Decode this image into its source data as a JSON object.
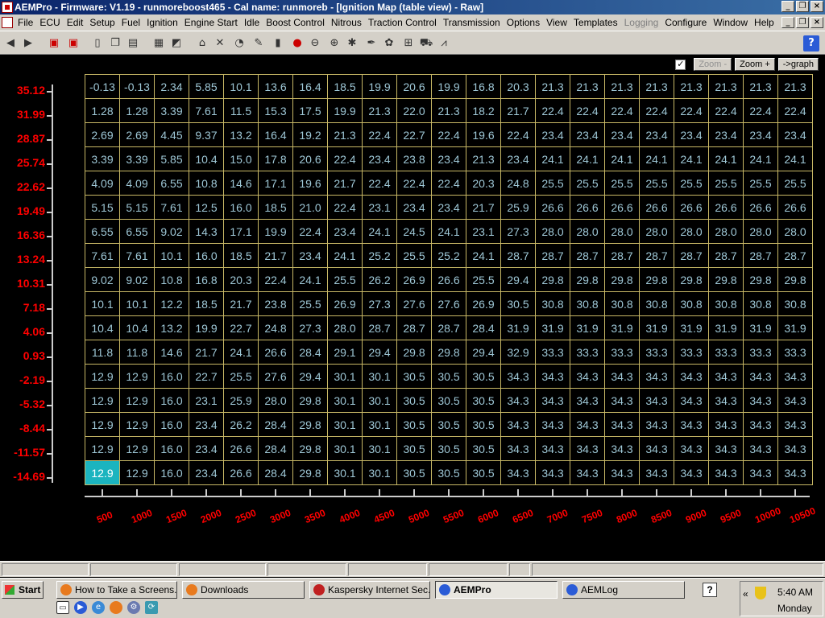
{
  "window": {
    "title": "AEMPro - Firmware: V1.19 - runmoreboost465 - Cal name: runmoreb - [Ignition Map (table view) - Raw]"
  },
  "menu": [
    "File",
    "ECU",
    "Edit",
    "Setup",
    "Fuel",
    "Ignition",
    "Engine Start",
    "Idle",
    "Boost Control",
    "Nitrous",
    "Traction Control",
    "Transmission",
    "Options",
    "View",
    "Templates",
    "Logging",
    "Configure",
    "Window",
    "Help"
  ],
  "menu_disabled": [
    "Logging"
  ],
  "toolbar_icons": [
    "back-arrow-icon",
    "forward-arrow-icon",
    "ecu-open-icon",
    "ecu-save-icon",
    "new-document-icon",
    "copy-document-icon",
    "paste-document-icon",
    "table-icon",
    "chart-icon",
    "home-icon",
    "tools-icon",
    "gauge-icon",
    "wrench-icon",
    "injector-icon",
    "start-icon",
    "stop-icon",
    "compass-icon",
    "turbo-icon",
    "spark-icon",
    "auto-icon",
    "grid-icon",
    "car-icon",
    "graph-icon",
    "help-icon"
  ],
  "zoom": {
    "checked": true,
    "zoom_out": "Zoom -",
    "zoom_in": "Zoom +",
    "graph": "->graph"
  },
  "chart_data": {
    "type": "table",
    "y_labels": [
      "35.12",
      "31.99",
      "28.87",
      "25.74",
      "22.62",
      "19.49",
      "16.36",
      "13.24",
      "10.31",
      "7.18",
      "4.06",
      "0.93",
      "-2.19",
      "-5.32",
      "-8.44",
      "-11.57",
      "-14.69"
    ],
    "x_labels": [
      "500",
      "1000",
      "1500",
      "2000",
      "2500",
      "3000",
      "3500",
      "4000",
      "4500",
      "5000",
      "5500",
      "6000",
      "6500",
      "7000",
      "7500",
      "8000",
      "8500",
      "9000",
      "9500",
      "10000",
      "10500"
    ],
    "rows": [
      [
        "-0.13",
        "-0.13",
        "2.34",
        "5.85",
        "10.1",
        "13.6",
        "16.4",
        "18.5",
        "19.9",
        "20.6",
        "19.9",
        "16.8",
        "20.3",
        "21.3",
        "21.3",
        "21.3",
        "21.3",
        "21.3",
        "21.3",
        "21.3",
        "21.3"
      ],
      [
        "1.28",
        "1.28",
        "3.39",
        "7.61",
        "11.5",
        "15.3",
        "17.5",
        "19.9",
        "21.3",
        "22.0",
        "21.3",
        "18.2",
        "21.7",
        "22.4",
        "22.4",
        "22.4",
        "22.4",
        "22.4",
        "22.4",
        "22.4",
        "22.4"
      ],
      [
        "2.69",
        "2.69",
        "4.45",
        "9.37",
        "13.2",
        "16.4",
        "19.2",
        "21.3",
        "22.4",
        "22.7",
        "22.4",
        "19.6",
        "22.4",
        "23.4",
        "23.4",
        "23.4",
        "23.4",
        "23.4",
        "23.4",
        "23.4",
        "23.4"
      ],
      [
        "3.39",
        "3.39",
        "5.85",
        "10.4",
        "15.0",
        "17.8",
        "20.6",
        "22.4",
        "23.4",
        "23.8",
        "23.4",
        "21.3",
        "23.4",
        "24.1",
        "24.1",
        "24.1",
        "24.1",
        "24.1",
        "24.1",
        "24.1",
        "24.1"
      ],
      [
        "4.09",
        "4.09",
        "6.55",
        "10.8",
        "14.6",
        "17.1",
        "19.6",
        "21.7",
        "22.4",
        "22.4",
        "22.4",
        "20.3",
        "24.8",
        "25.5",
        "25.5",
        "25.5",
        "25.5",
        "25.5",
        "25.5",
        "25.5",
        "25.5"
      ],
      [
        "5.15",
        "5.15",
        "7.61",
        "12.5",
        "16.0",
        "18.5",
        "21.0",
        "22.4",
        "23.1",
        "23.4",
        "23.4",
        "21.7",
        "25.9",
        "26.6",
        "26.6",
        "26.6",
        "26.6",
        "26.6",
        "26.6",
        "26.6",
        "26.6"
      ],
      [
        "6.55",
        "6.55",
        "9.02",
        "14.3",
        "17.1",
        "19.9",
        "22.4",
        "23.4",
        "24.1",
        "24.5",
        "24.1",
        "23.1",
        "27.3",
        "28.0",
        "28.0",
        "28.0",
        "28.0",
        "28.0",
        "28.0",
        "28.0",
        "28.0"
      ],
      [
        "7.61",
        "7.61",
        "10.1",
        "16.0",
        "18.5",
        "21.7",
        "23.4",
        "24.1",
        "25.2",
        "25.5",
        "25.2",
        "24.1",
        "28.7",
        "28.7",
        "28.7",
        "28.7",
        "28.7",
        "28.7",
        "28.7",
        "28.7",
        "28.7"
      ],
      [
        "9.02",
        "9.02",
        "10.8",
        "16.8",
        "20.3",
        "22.4",
        "24.1",
        "25.5",
        "26.2",
        "26.9",
        "26.6",
        "25.5",
        "29.4",
        "29.8",
        "29.8",
        "29.8",
        "29.8",
        "29.8",
        "29.8",
        "29.8",
        "29.8"
      ],
      [
        "10.1",
        "10.1",
        "12.2",
        "18.5",
        "21.7",
        "23.8",
        "25.5",
        "26.9",
        "27.3",
        "27.6",
        "27.6",
        "26.9",
        "30.5",
        "30.8",
        "30.8",
        "30.8",
        "30.8",
        "30.8",
        "30.8",
        "30.8",
        "30.8"
      ],
      [
        "10.4",
        "10.4",
        "13.2",
        "19.9",
        "22.7",
        "24.8",
        "27.3",
        "28.0",
        "28.7",
        "28.7",
        "28.7",
        "28.4",
        "31.9",
        "31.9",
        "31.9",
        "31.9",
        "31.9",
        "31.9",
        "31.9",
        "31.9",
        "31.9"
      ],
      [
        "11.8",
        "11.8",
        "14.6",
        "21.7",
        "24.1",
        "26.6",
        "28.4",
        "29.1",
        "29.4",
        "29.8",
        "29.8",
        "29.4",
        "32.9",
        "33.3",
        "33.3",
        "33.3",
        "33.3",
        "33.3",
        "33.3",
        "33.3",
        "33.3"
      ],
      [
        "12.9",
        "12.9",
        "16.0",
        "22.7",
        "25.5",
        "27.6",
        "29.4",
        "30.1",
        "30.1",
        "30.5",
        "30.5",
        "30.5",
        "34.3",
        "34.3",
        "34.3",
        "34.3",
        "34.3",
        "34.3",
        "34.3",
        "34.3",
        "34.3"
      ],
      [
        "12.9",
        "12.9",
        "16.0",
        "23.1",
        "25.9",
        "28.0",
        "29.8",
        "30.1",
        "30.1",
        "30.5",
        "30.5",
        "30.5",
        "34.3",
        "34.3",
        "34.3",
        "34.3",
        "34.3",
        "34.3",
        "34.3",
        "34.3",
        "34.3"
      ],
      [
        "12.9",
        "12.9",
        "16.0",
        "23.4",
        "26.2",
        "28.4",
        "29.8",
        "30.1",
        "30.1",
        "30.5",
        "30.5",
        "30.5",
        "34.3",
        "34.3",
        "34.3",
        "34.3",
        "34.3",
        "34.3",
        "34.3",
        "34.3",
        "34.3"
      ],
      [
        "12.9",
        "12.9",
        "16.0",
        "23.4",
        "26.6",
        "28.4",
        "29.8",
        "30.1",
        "30.1",
        "30.5",
        "30.5",
        "30.5",
        "34.3",
        "34.3",
        "34.3",
        "34.3",
        "34.3",
        "34.3",
        "34.3",
        "34.3",
        "34.3"
      ],
      [
        "12.9",
        "12.9",
        "16.0",
        "23.4",
        "26.6",
        "28.4",
        "29.8",
        "30.1",
        "30.1",
        "30.5",
        "30.5",
        "30.5",
        "34.3",
        "34.3",
        "34.3",
        "34.3",
        "34.3",
        "34.3",
        "34.3",
        "34.3",
        "34.3"
      ]
    ],
    "selected_cell": {
      "row": 16,
      "col": 0
    }
  },
  "taskbar": {
    "start": "Start",
    "tasks": [
      {
        "label": "How to Take a Screens...",
        "active": false
      },
      {
        "label": "Downloads",
        "active": false
      },
      {
        "label": "Kaspersky Internet Sec...",
        "active": false
      },
      {
        "label": "AEMPro",
        "active": true
      },
      {
        "label": "AEMLog",
        "active": false
      }
    ],
    "clock": "5:40 AM",
    "day": "Monday"
  },
  "colors": {
    "title_bar": "#0a246a",
    "grid_line": "#c8b866",
    "cell_text": "#9ec7d6",
    "axis_label": "#ff0000",
    "selected_cell": "#1bb4bf"
  }
}
